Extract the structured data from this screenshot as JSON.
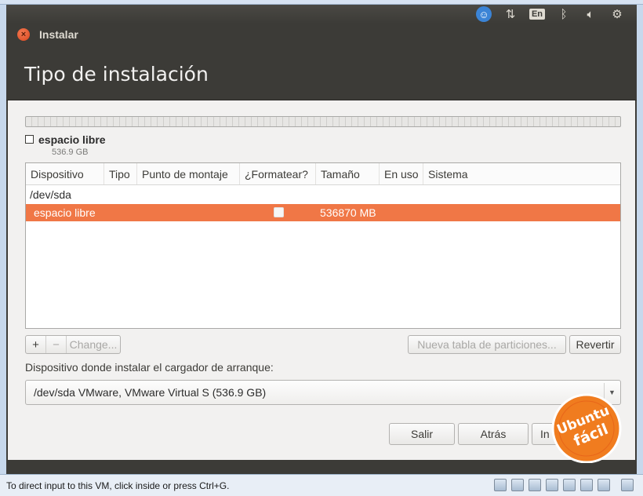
{
  "panel": {
    "keyboard_layout": "En",
    "icons": [
      "accessibility-icon",
      "network-icon",
      "keyboard-layout-icon",
      "bluetooth-icon",
      "volume-icon",
      "settings-icon"
    ]
  },
  "window": {
    "title": "Instalar"
  },
  "header": {
    "title": "Tipo de instalación"
  },
  "legend": {
    "name": "espacio libre",
    "size": "536.9 GB"
  },
  "table": {
    "headers": [
      "Dispositivo",
      "Tipo",
      "Punto de montaje",
      "¿Formatear?",
      "Tamaño",
      "En uso",
      "Sistema"
    ],
    "device_group": "/dev/sda",
    "selected_row": {
      "device": "espacio libre",
      "size": "536870 MB"
    }
  },
  "controls": {
    "add": "+",
    "remove": "−",
    "change": "Change...",
    "new_table": "Nueva tabla de particiones...",
    "revert": "Revertir"
  },
  "boot": {
    "label": "Dispositivo donde instalar el cargador de arranque:",
    "selected": "/dev/sda  VMware, VMware Virtual S (536.9 GB)"
  },
  "buttons": {
    "quit": "Salir",
    "back": "Atrás",
    "install": "In"
  },
  "watermark": {
    "line1": "Ubuntu",
    "line2": "fácil"
  },
  "statusbar": {
    "text": "To direct input to this VM, click inside or press Ctrl+G."
  },
  "colors": {
    "accent": "#f07746",
    "panel": "#3c3b37",
    "background": "#f2f1f0"
  }
}
